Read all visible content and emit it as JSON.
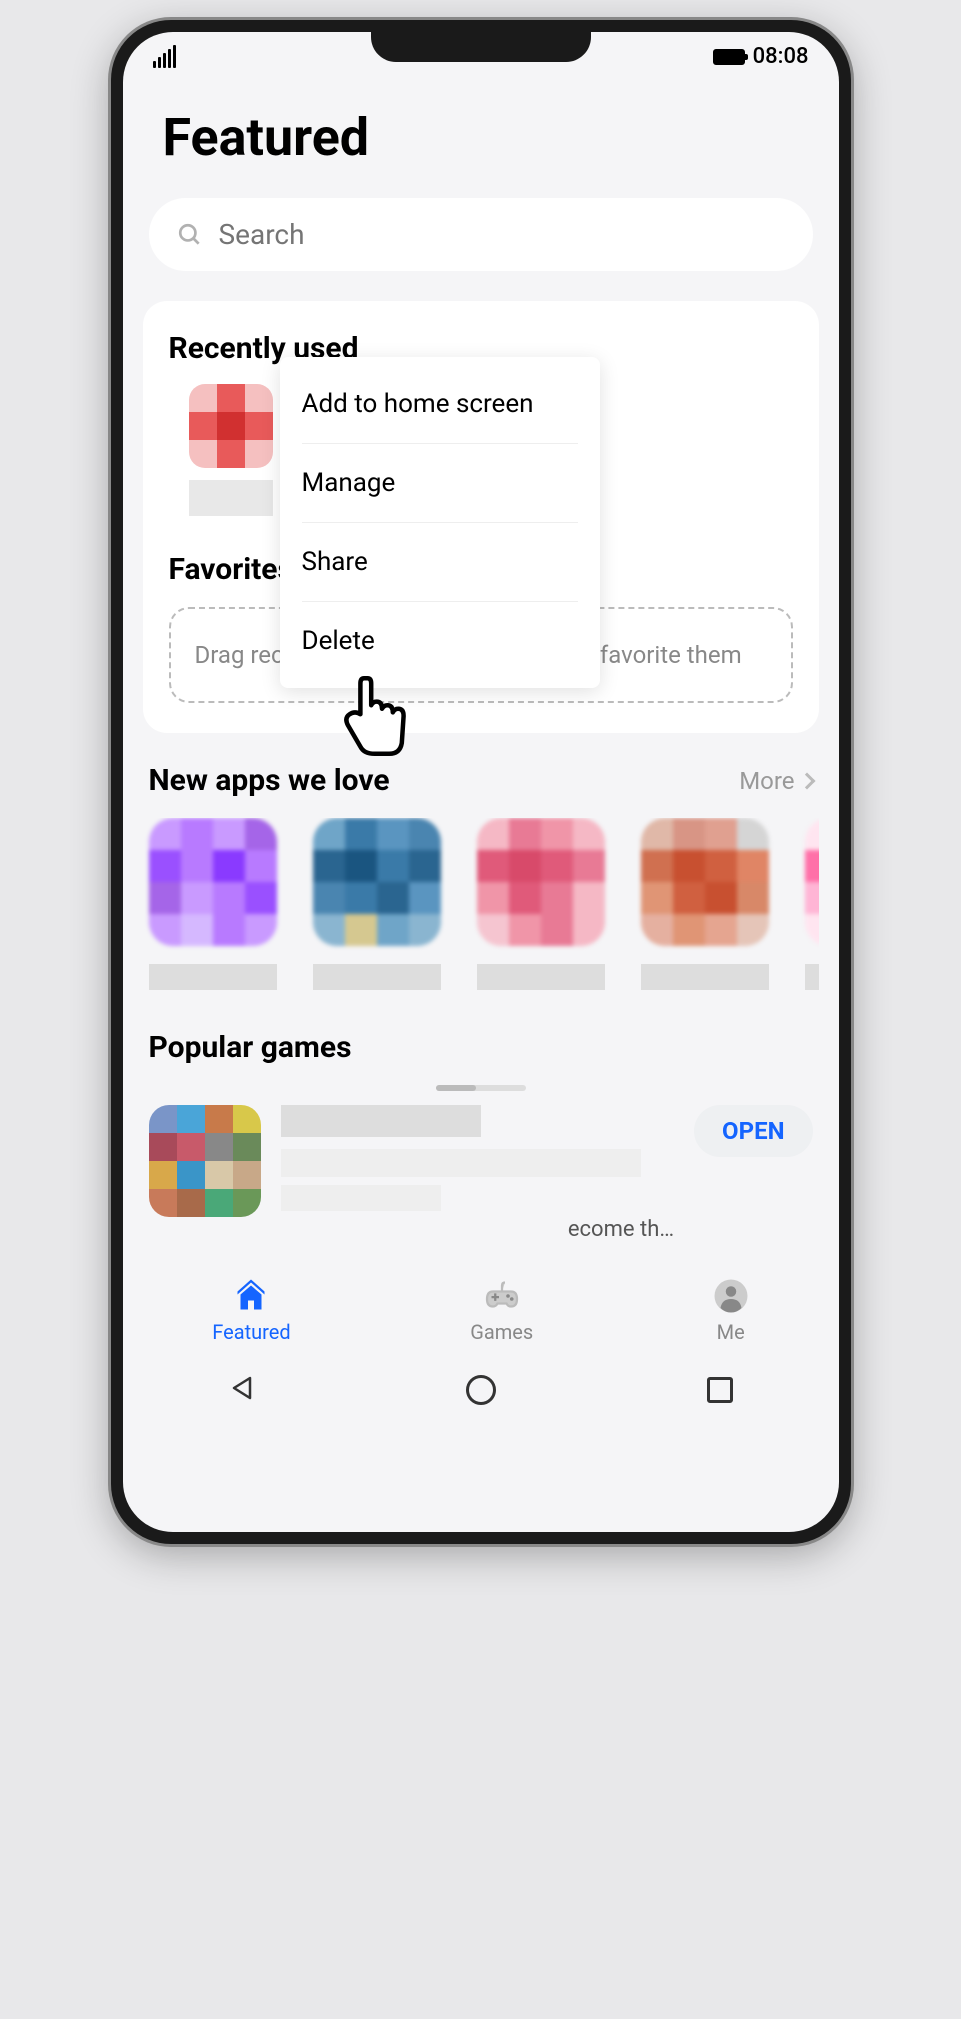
{
  "status_bar": {
    "time": "08:08"
  },
  "page": {
    "title": "Featured"
  },
  "search": {
    "placeholder": "Search"
  },
  "recently_used": {
    "title": "Recently used"
  },
  "context_menu": {
    "items": [
      "Add to home screen",
      "Manage",
      "Share",
      "Delete"
    ]
  },
  "favorites": {
    "title": "Favorites",
    "hint": "Drag recently used quick apps here to favorite them"
  },
  "new_apps": {
    "title": "New apps we love",
    "more": "More"
  },
  "popular_games": {
    "title": "Popular games",
    "open_button": "OPEN",
    "description_fragment": "ecome th…"
  },
  "tabs": [
    {
      "label": "Featured",
      "active": true
    },
    {
      "label": "Games",
      "active": false
    },
    {
      "label": "Me",
      "active": false
    }
  ],
  "app_tiles": {
    "recent": [
      [
        "#f5c0c0",
        "#e85a5a",
        "#f5c0c0",
        "#e85a5a",
        "#d13030",
        "#e85a5a",
        "#f5c0c0",
        "#e85a5a",
        "#f5c0c0"
      ]
    ],
    "new_apps_colors": [
      [
        "#c99aff",
        "#b87aff",
        "#c99aff",
        "#a565e8",
        "#9a50ff",
        "#b87aff",
        "#8a3aff",
        "#b87aff",
        "#a565e8",
        "#c99aff",
        "#b87aff",
        "#9a50ff",
        "#c99aff",
        "#d5b8ff",
        "#b87aff",
        "#c99aff"
      ],
      [
        "#6fa5c8",
        "#3a7aa8",
        "#5a95c0",
        "#4a85b0",
        "#2a6590",
        "#1a5580",
        "#3a7aa8",
        "#2a6590",
        "#4a85b0",
        "#3a7aa8",
        "#2a6590",
        "#5a95c0",
        "#8ab5d0",
        "#d5c890",
        "#6fa5c8",
        "#8ab5d0"
      ],
      [
        "#f5b8c5",
        "#e87a95",
        "#f095a8",
        "#f5b8c5",
        "#e05a7a",
        "#d84a6a",
        "#e05a7a",
        "#e87a95",
        "#f095a8",
        "#e05a7a",
        "#e87a95",
        "#f5b8c5",
        "#f5c5d0",
        "#f095a8",
        "#e87a95",
        "#f5b8c5"
      ],
      [
        "#e0b8a8",
        "#d89585",
        "#e0a090",
        "#d5d5d5",
        "#d07050",
        "#c85030",
        "#d06040",
        "#e08565",
        "#e09575",
        "#d06040",
        "#c85030",
        "#d88868",
        "#e5b0a0",
        "#e09575",
        "#e5a590",
        "#e5c5b8"
      ],
      [
        "#ffe5f0",
        "#ff9ac5",
        "#ffb5d5",
        "#ffe5f0",
        "#ff70a8",
        "#ff5090",
        "#ff70a8",
        "#ff9ac5",
        "#ffb5d5",
        "#ff70a8",
        "#ff5090",
        "#ff9ac5",
        "#ffe5f0",
        "#ffb5d5",
        "#ff9ac5",
        "#ffe5f0"
      ]
    ],
    "popular_icon": [
      "#7a95c8",
      "#4aa5d8",
      "#c87a4a",
      "#d8c84a",
      "#a84a5a",
      "#c85a6a",
      "#888888",
      "#6a8a5a",
      "#d8a84a",
      "#3a95c8",
      "#d8c8a8",
      "#c8a888",
      "#c87a5a",
      "#a86a4a",
      "#4aa878",
      "#6a9858"
    ]
  }
}
